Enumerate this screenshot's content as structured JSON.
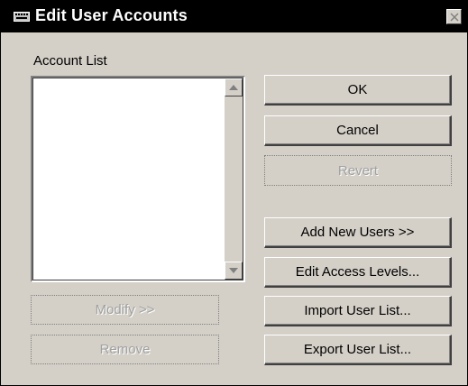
{
  "window": {
    "title": "Edit User Accounts",
    "title_icon": "keyboard-icon",
    "close_icon": "close-icon"
  },
  "account_list": {
    "label": "Account List",
    "items": []
  },
  "buttons": {
    "ok": "OK",
    "cancel": "Cancel",
    "revert": "Revert",
    "add_new_users": "Add New Users >>",
    "edit_access_levels": "Edit Access Levels...",
    "import_user_list": "Import User List...",
    "export_user_list": "Export User List...",
    "modify": "Modify >>",
    "remove": "Remove"
  },
  "states": {
    "revert_enabled": false,
    "modify_enabled": false,
    "remove_enabled": false
  },
  "colors": {
    "face": "#d4d0c8",
    "titlebar": "#000000",
    "disabled_text": "#a0a0a0"
  }
}
